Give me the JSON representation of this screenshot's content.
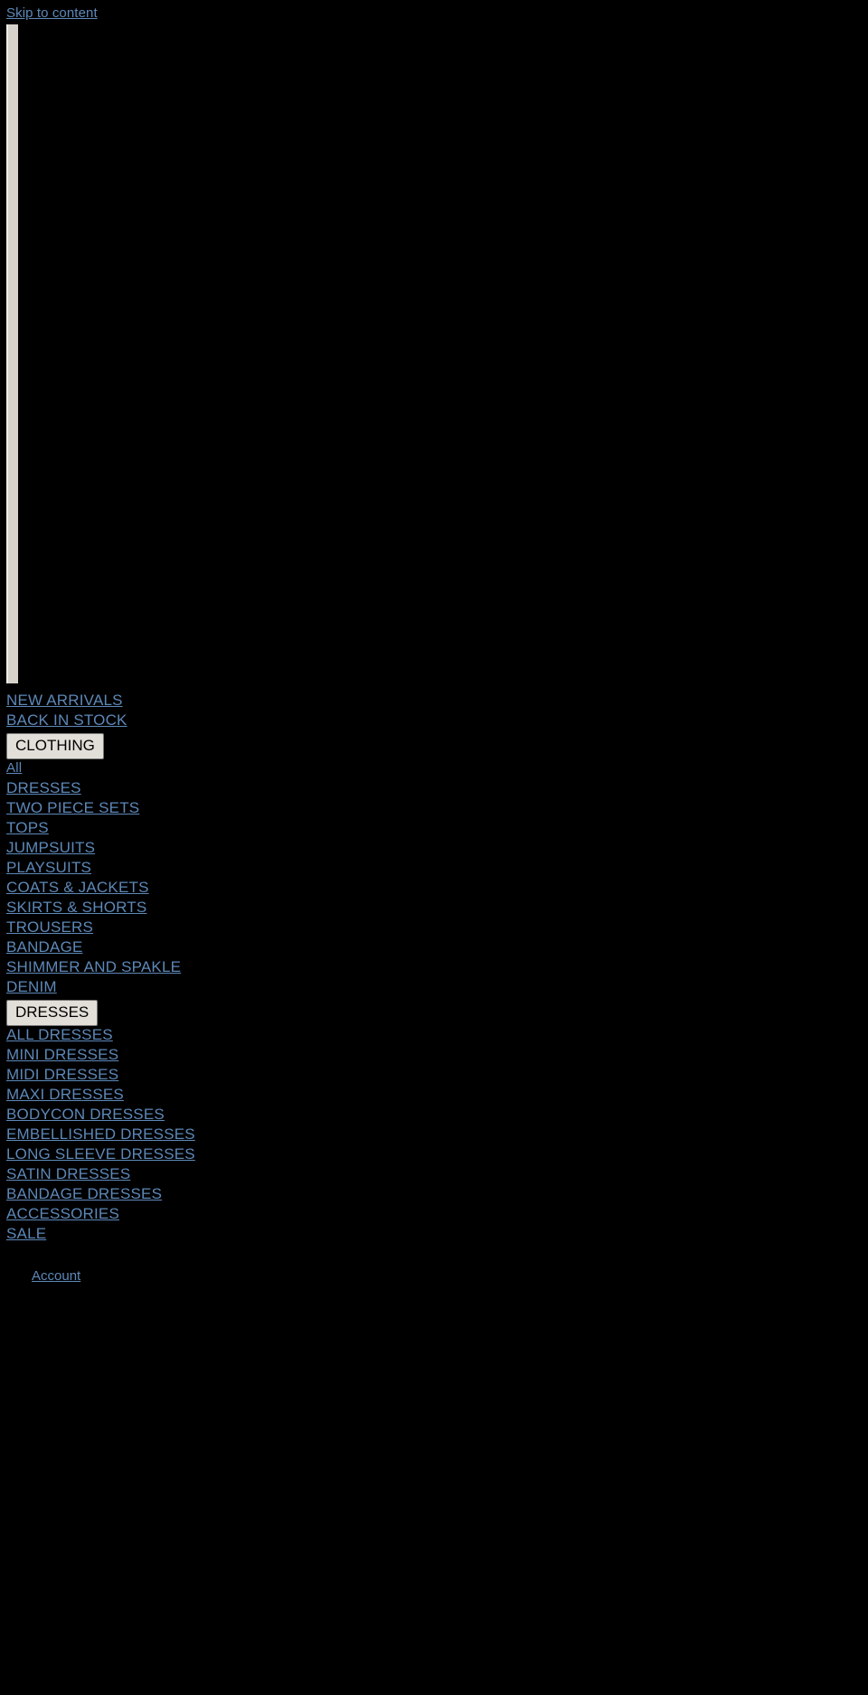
{
  "skip": {
    "label": "Skip to content"
  },
  "logo": {
    "alt": ""
  },
  "nav": {
    "top_items": [
      {
        "label": "NEW ARRIVALS"
      },
      {
        "label": "BACK IN STOCK"
      }
    ],
    "groups": [
      {
        "title": "CLOTHING",
        "items": [
          {
            "label": "All"
          },
          {
            "label": "DRESSES"
          },
          {
            "label": "TWO PIECE SETS"
          },
          {
            "label": "TOPS"
          },
          {
            "label": "JUMPSUITS"
          },
          {
            "label": "PLAYSUITS"
          },
          {
            "label": "COATS & JACKETS"
          },
          {
            "label": "SKIRTS & SHORTS"
          },
          {
            "label": "TROUSERS"
          },
          {
            "label": "BANDAGE"
          },
          {
            "label": "SHIMMER AND SPAKLE"
          },
          {
            "label": "DENIM"
          }
        ]
      },
      {
        "title": "DRESSES",
        "items": [
          {
            "label": "ALL DRESSES"
          },
          {
            "label": "MINI DRESSES"
          },
          {
            "label": "MIDI DRESSES"
          },
          {
            "label": "MAXI DRESSES"
          },
          {
            "label": "BODYCON DRESSES"
          },
          {
            "label": "EMBELLISHED DRESSES"
          },
          {
            "label": "LONG SLEEVE DRESSES"
          },
          {
            "label": "SATIN DRESSES"
          },
          {
            "label": "BANDAGE DRESSES"
          }
        ]
      }
    ],
    "bottom_items": [
      {
        "label": "ACCESSORIES"
      },
      {
        "label": "SALE"
      }
    ]
  },
  "account": {
    "label": "Account"
  },
  "colors": {
    "background": "#000000",
    "link": "#5d88b8",
    "button_background": "#e2dfd8",
    "button_text": "#000000",
    "placeholder": "#d6d2ca"
  }
}
